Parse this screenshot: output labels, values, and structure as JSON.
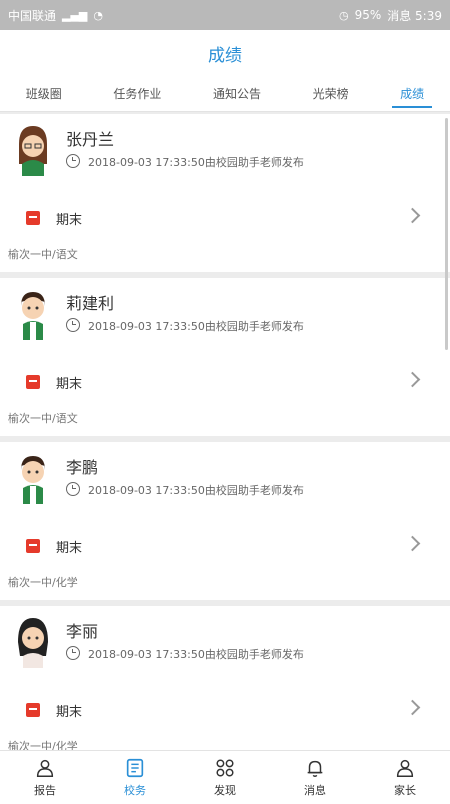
{
  "status_bar": {
    "carrier": "中国联通",
    "battery": "95%",
    "time": "消息 5:39"
  },
  "header": {
    "title": "成绩"
  },
  "tabs": [
    {
      "label": "班级圈",
      "active": false
    },
    {
      "label": "任务作业",
      "active": false
    },
    {
      "label": "通知公告",
      "active": false
    },
    {
      "label": "光荣榜",
      "active": false
    },
    {
      "label": "成绩",
      "active": true
    }
  ],
  "cards": [
    {
      "name": "张丹兰",
      "meta": "2018-09-03 17:33:50由校园助手老师发布",
      "exam": "期末",
      "footer": "榆次一中/语文",
      "avatar": "female-avatar"
    },
    {
      "name": "莉建利",
      "meta": "2018-09-03 17:33:50由校园助手老师发布",
      "exam": "期末",
      "footer": "榆次一中/语文",
      "avatar": "male-avatar"
    },
    {
      "name": "李鹏",
      "meta": "2018-09-03 17:33:50由校园助手老师发布",
      "exam": "期末",
      "footer": "榆次一中/化学",
      "avatar": "male-avatar"
    },
    {
      "name": "李丽",
      "meta": "2018-09-03 17:33:50由校园助手老师发布",
      "exam": "期末",
      "footer": "榆次一中/化学",
      "avatar": "female-avatar"
    }
  ],
  "bottom_nav": [
    {
      "label": "报告",
      "icon": "report-icon",
      "active": false
    },
    {
      "label": "校务",
      "icon": "school-affairs-icon",
      "active": true
    },
    {
      "label": "发现",
      "icon": "discover-icon",
      "active": false
    },
    {
      "label": "消息",
      "icon": "bell-icon",
      "active": false
    },
    {
      "label": "家长",
      "icon": "parent-icon",
      "active": false
    }
  ],
  "colors": {
    "accent": "#2a8fd6",
    "exam_icon": "#e53a2b",
    "background": "#ececec"
  }
}
